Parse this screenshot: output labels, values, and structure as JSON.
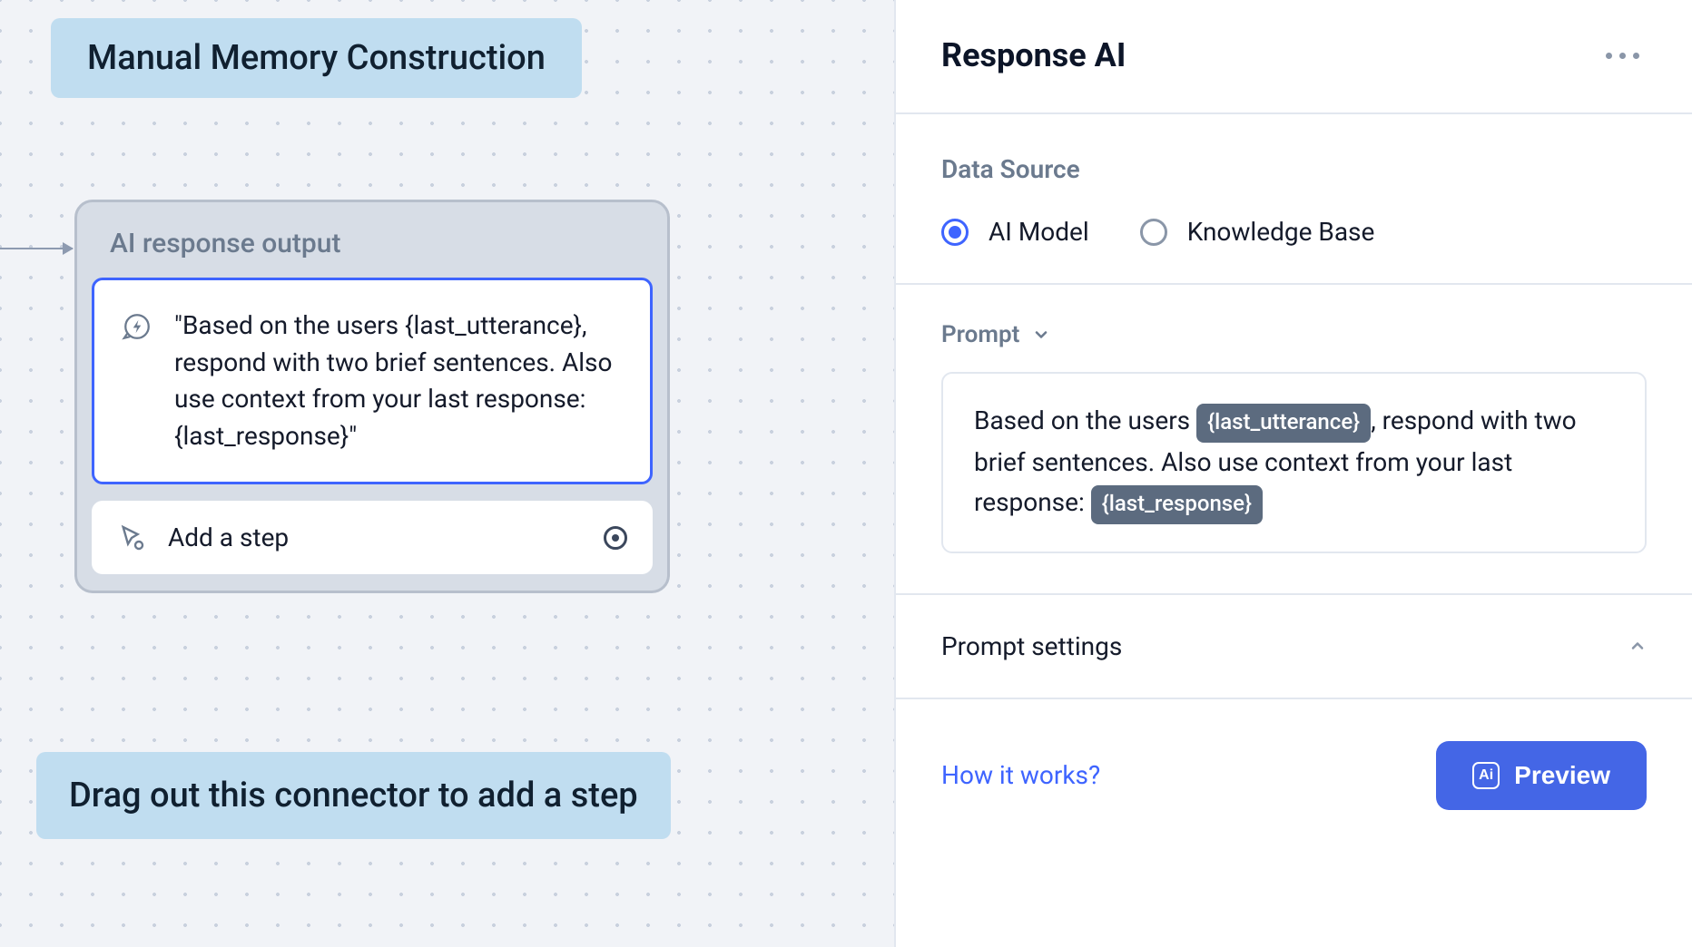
{
  "canvas": {
    "title_badge": "Manual Memory Construction",
    "bottom_badge": "Drag out this connector to add a step",
    "node": {
      "title": "AI response output",
      "prompt_text": "\"Based on the users {last_utterance}, respond with two brief sentences. Also use context from your last response: {last_response}\"",
      "add_step_label": "Add a step"
    }
  },
  "panel": {
    "title": "Response AI",
    "data_source": {
      "section_label": "Data Source",
      "options": [
        {
          "label": "AI Model",
          "selected": true
        },
        {
          "label": "Knowledge Base",
          "selected": false
        }
      ]
    },
    "prompt": {
      "label": "Prompt",
      "segments": [
        {
          "type": "text",
          "value": "Based on the users "
        },
        {
          "type": "chip",
          "value": "{last_utterance}"
        },
        {
          "type": "text",
          "value": ", respond with two brief sentences. Also use context from your last response: "
        },
        {
          "type": "chip",
          "value": "{last_response}"
        }
      ]
    },
    "prompt_settings_label": "Prompt settings",
    "footer": {
      "how_it_works": "How it works?",
      "preview_label": "Preview",
      "ai_badge": "Ai"
    }
  }
}
